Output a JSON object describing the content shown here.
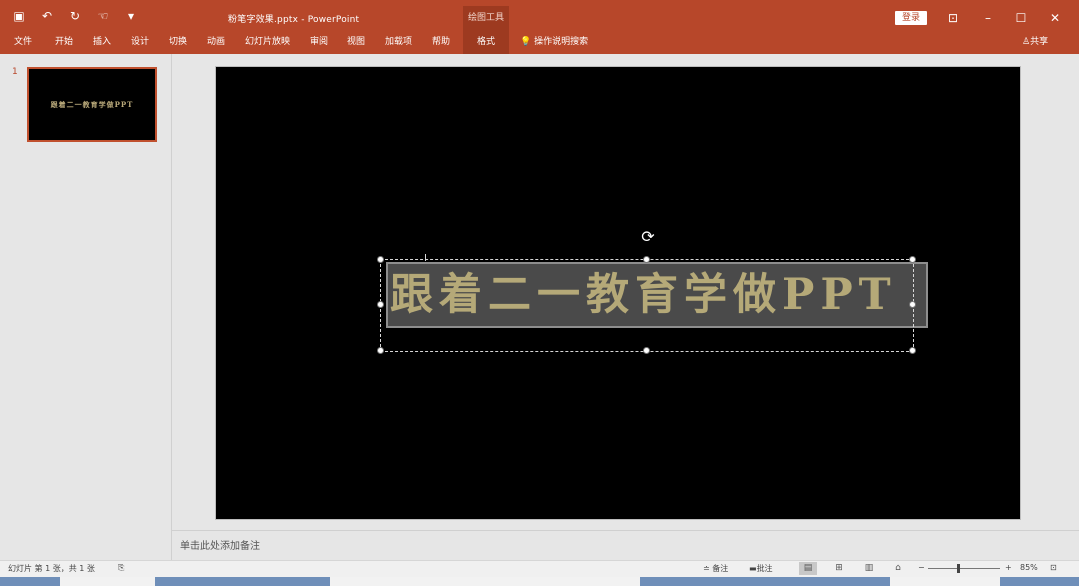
{
  "titlebar": {
    "doc_title": "粉笔字效果.pptx  -  PowerPoint",
    "tool_tab_head": "绘图工具",
    "login": "登录",
    "qat_icons": [
      "save-icon",
      "undo-icon",
      "redo-icon",
      "touch-mode-icon",
      "customize-qat-icon"
    ]
  },
  "ribbon": {
    "tabs": [
      "文件",
      "开始",
      "插入",
      "设计",
      "切换",
      "动画",
      "幻灯片放映",
      "审阅",
      "视图",
      "加载项",
      "帮助",
      "格式"
    ],
    "tell_me": "操作说明搜索",
    "share": "共享"
  },
  "thumbnails": [
    {
      "number": "1",
      "text": "跟着二一教育学做PPT"
    }
  ],
  "slide": {
    "text": "跟着二一教育学做PPT"
  },
  "notes": {
    "placeholder": "单击此处添加备注"
  },
  "statusbar": {
    "slide_info": "幻灯片 第 1 张，共 1 张",
    "notes_btn": "备注",
    "comments_btn": "批注",
    "zoom_minus": "−",
    "zoom_plus": "+",
    "zoom_level": "85%"
  },
  "colors": {
    "accent": "#b7472a",
    "slide_bg": "#000000",
    "text_chalk": "#b5a978"
  }
}
